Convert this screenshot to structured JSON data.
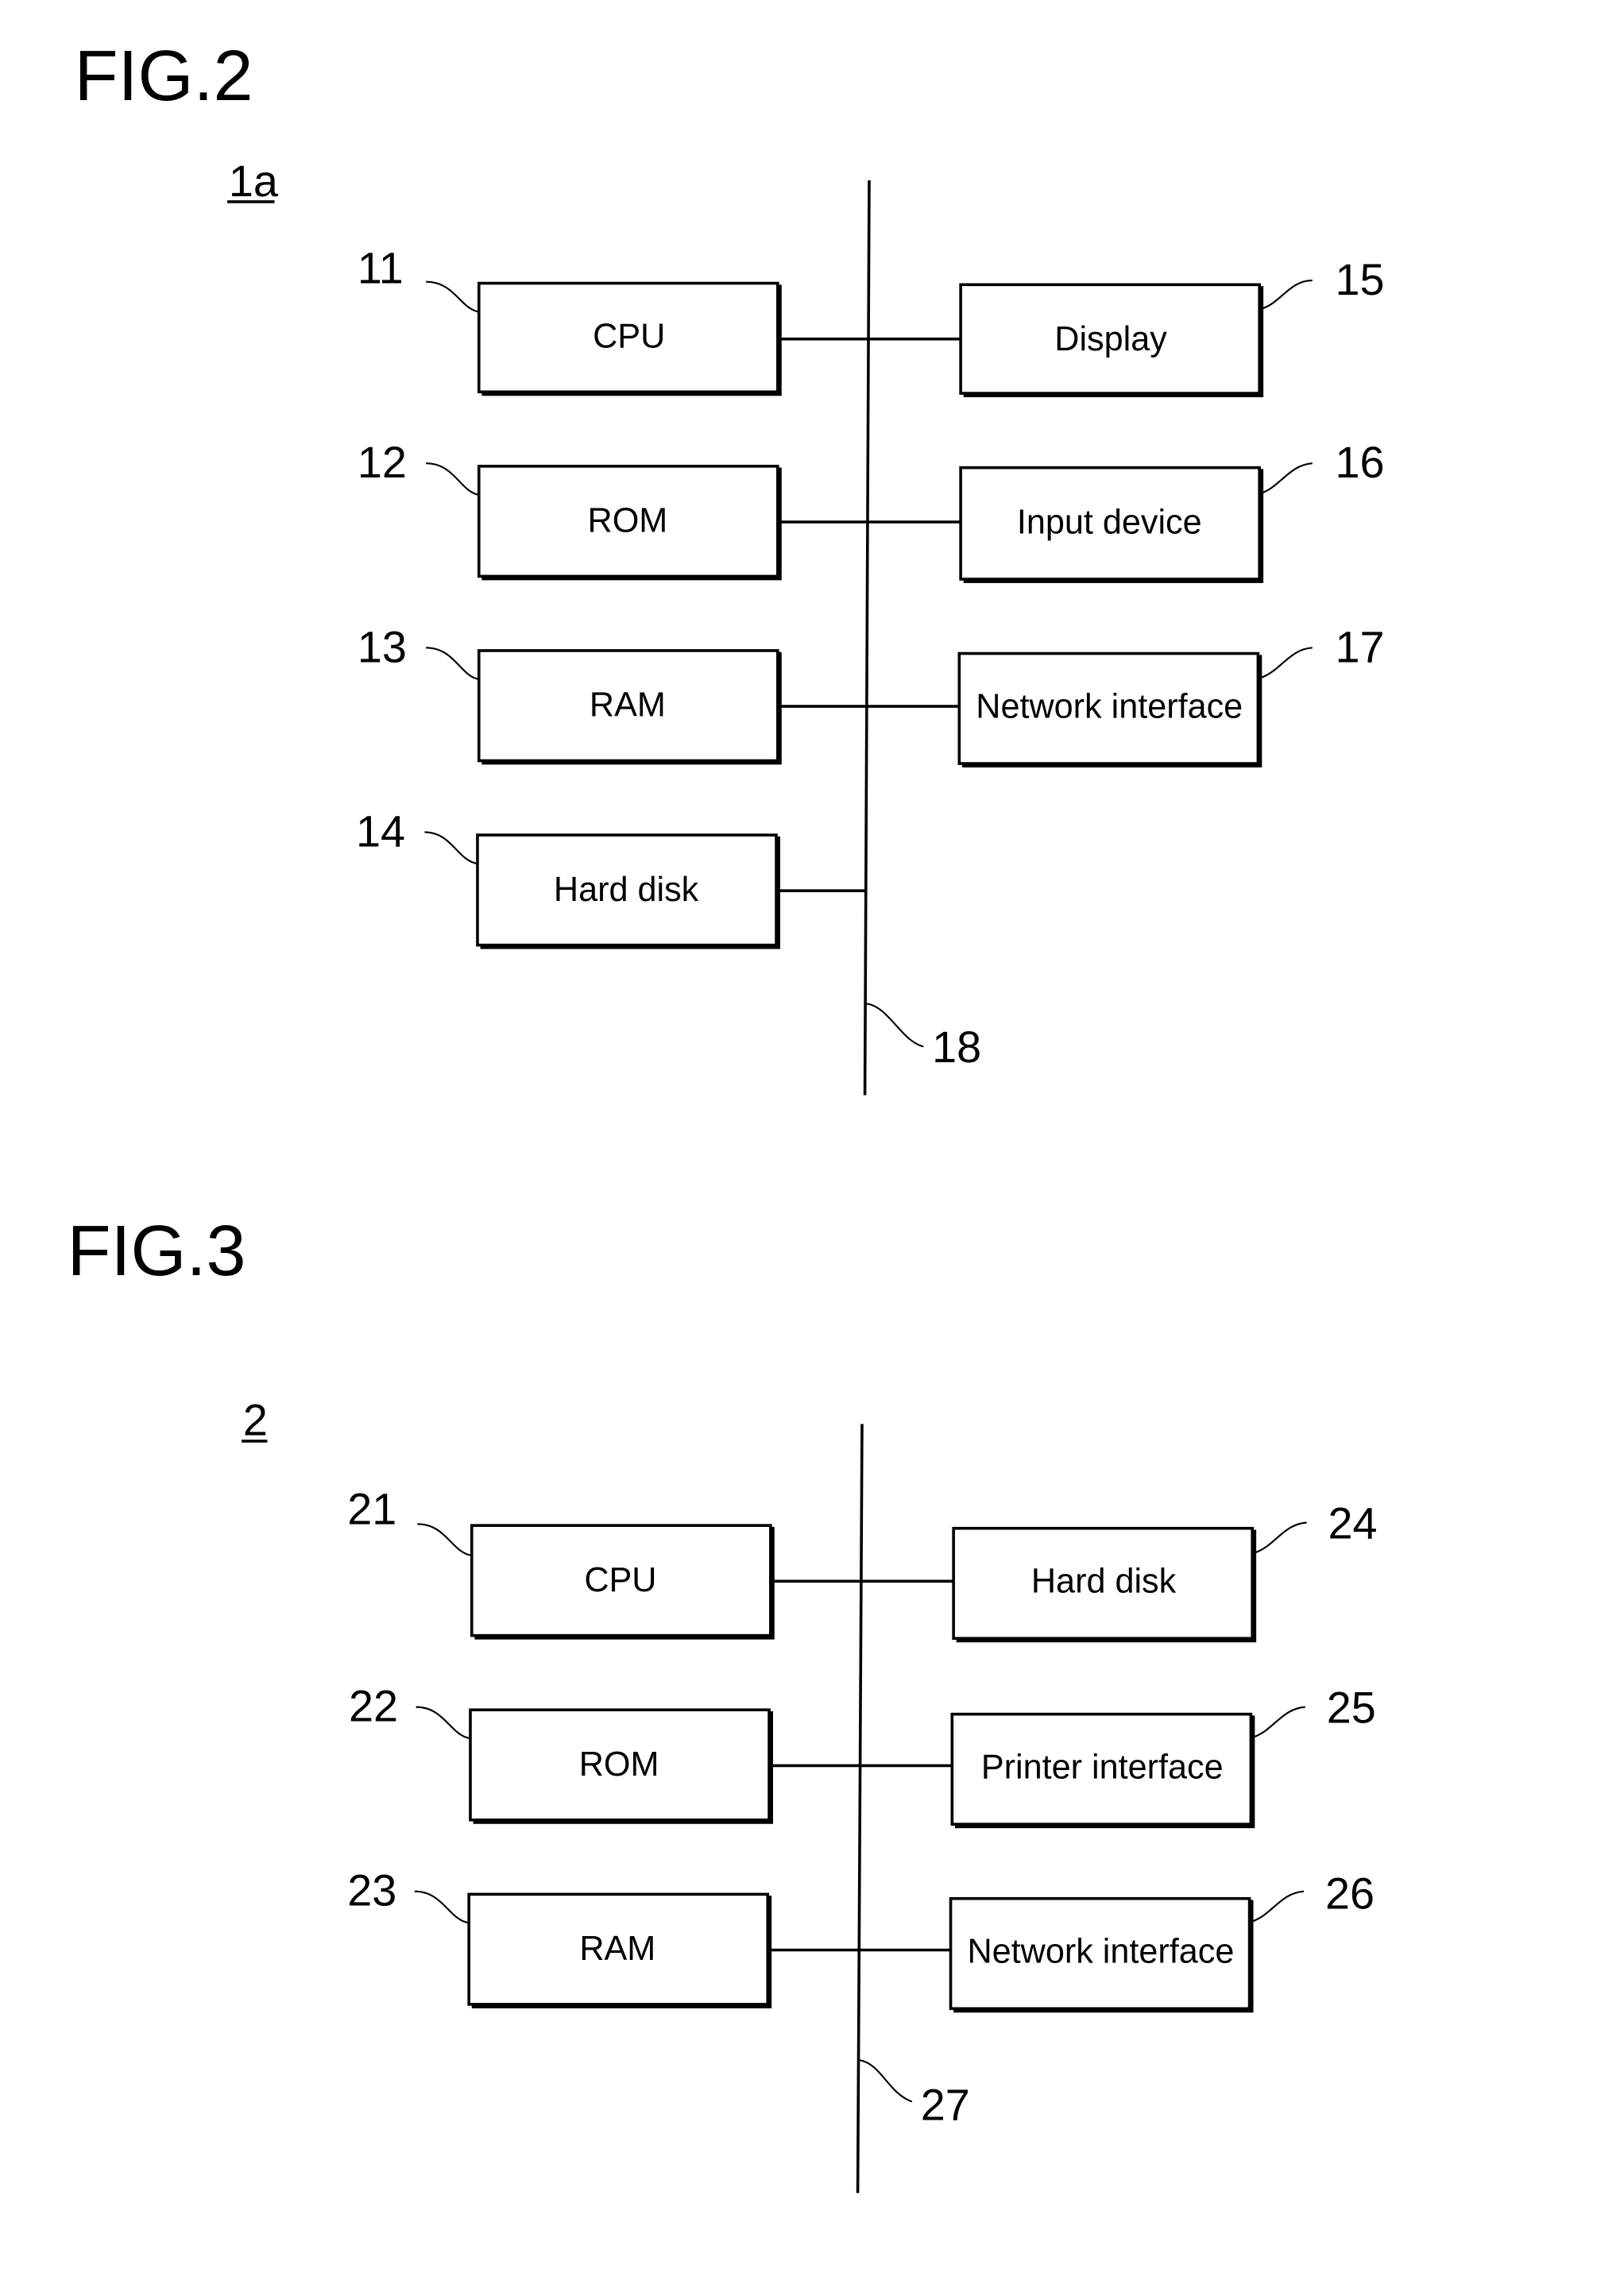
{
  "figures": [
    {
      "title": "FIG.2",
      "device_ref": "1a",
      "bus_ref": "18",
      "left_blocks": [
        {
          "ref": "11",
          "label": "CPU"
        },
        {
          "ref": "12",
          "label": "ROM"
        },
        {
          "ref": "13",
          "label": "RAM"
        },
        {
          "ref": "14",
          "label": "Hard disk"
        }
      ],
      "right_blocks": [
        {
          "ref": "15",
          "label": "Display"
        },
        {
          "ref": "16",
          "label": "Input device"
        },
        {
          "ref": "17",
          "label": "Network interface"
        }
      ]
    },
    {
      "title": "FIG.3",
      "device_ref": "2",
      "bus_ref": "27",
      "left_blocks": [
        {
          "ref": "21",
          "label": "CPU"
        },
        {
          "ref": "22",
          "label": "ROM"
        },
        {
          "ref": "23",
          "label": "RAM"
        }
      ],
      "right_blocks": [
        {
          "ref": "24",
          "label": "Hard disk"
        },
        {
          "ref": "25",
          "label": "Printer interface"
        },
        {
          "ref": "26",
          "label": "Network interface"
        }
      ]
    }
  ]
}
